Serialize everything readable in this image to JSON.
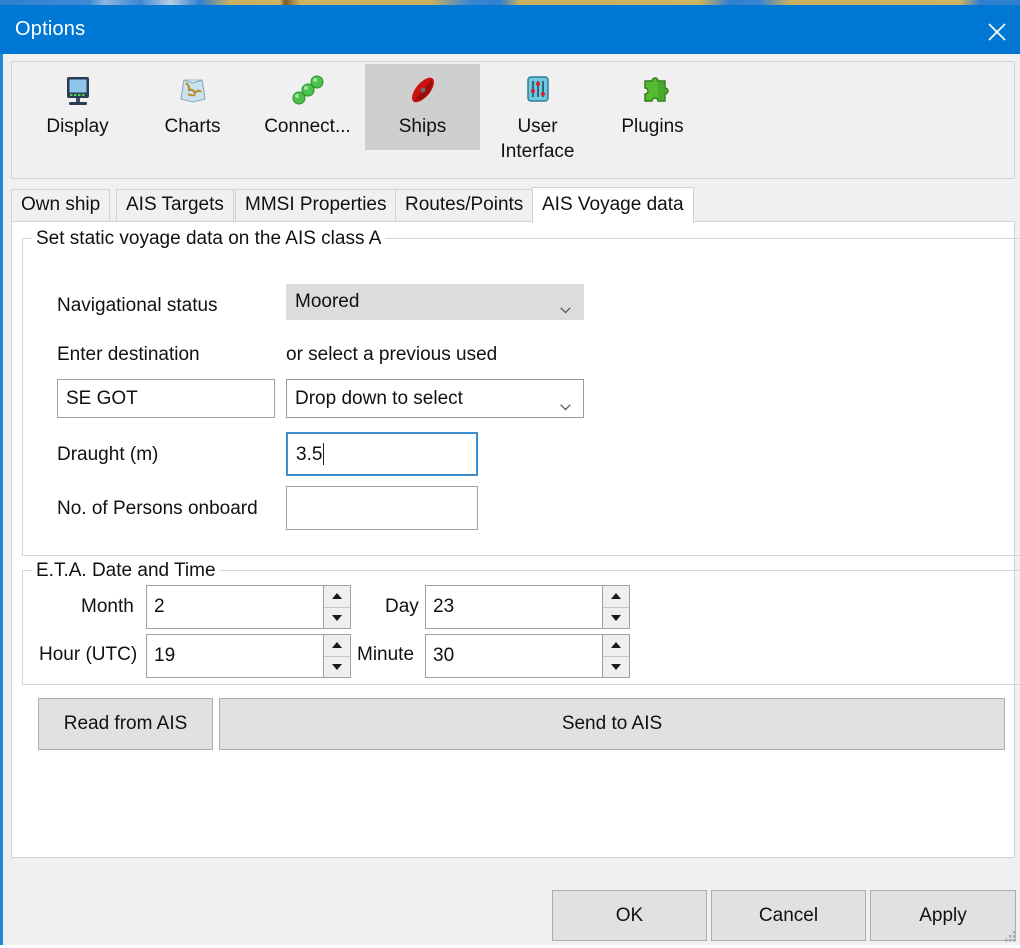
{
  "window": {
    "title": "Options",
    "close_icon": "close-icon"
  },
  "toolbar": {
    "items": [
      {
        "label": "Display",
        "icon": "monitor-icon",
        "selected": false
      },
      {
        "label": "Charts",
        "icon": "charts-icon",
        "selected": false
      },
      {
        "label": "Connect...",
        "icon": "connections-icon",
        "selected": false
      },
      {
        "label": "Ships",
        "icon": "ship-icon",
        "selected": true
      },
      {
        "label": "User Interface",
        "icon": "sliders-icon",
        "selected": false
      },
      {
        "label": "Plugins",
        "icon": "puzzle-piece-icon",
        "selected": false
      }
    ]
  },
  "tabs": [
    {
      "label": "Own ship",
      "active": false
    },
    {
      "label": "AIS Targets",
      "active": false
    },
    {
      "label": "MMSI Properties",
      "active": false
    },
    {
      "label": "Routes/Points",
      "active": false
    },
    {
      "label": "AIS Voyage data",
      "active": true
    }
  ],
  "voyage_group": {
    "legend": "Set static voyage data on the AIS class A",
    "nav_status_label": "Navigational status",
    "nav_status_value": "Moored",
    "destination_label": "Enter destination",
    "destination_value": "SE GOT",
    "previous_label": "or select a previous used",
    "previous_value": "Drop down to select",
    "draught_label": "Draught (m)",
    "draught_value": "3.5",
    "persons_label": "No. of Persons onboard",
    "persons_value": ""
  },
  "eta_group": {
    "legend": "E.T.A. Date and Time",
    "month_label": "Month",
    "month_value": "2",
    "day_label": "Day",
    "day_value": "23",
    "hour_label": "Hour (UTC)",
    "hour_value": "19",
    "minute_label": "Minute",
    "minute_value": "30"
  },
  "ais_buttons": {
    "read": "Read from AIS",
    "send": "Send to AIS"
  },
  "dialog_buttons": {
    "ok": "OK",
    "cancel": "Cancel",
    "apply": "Apply"
  },
  "colors": {
    "titlebar": "#0078d4",
    "accent_border": "#1d8bd1",
    "panel": "#f0f0f0",
    "selected_tool": "#cfcfcf",
    "focus_border": "#3b8fd1"
  }
}
